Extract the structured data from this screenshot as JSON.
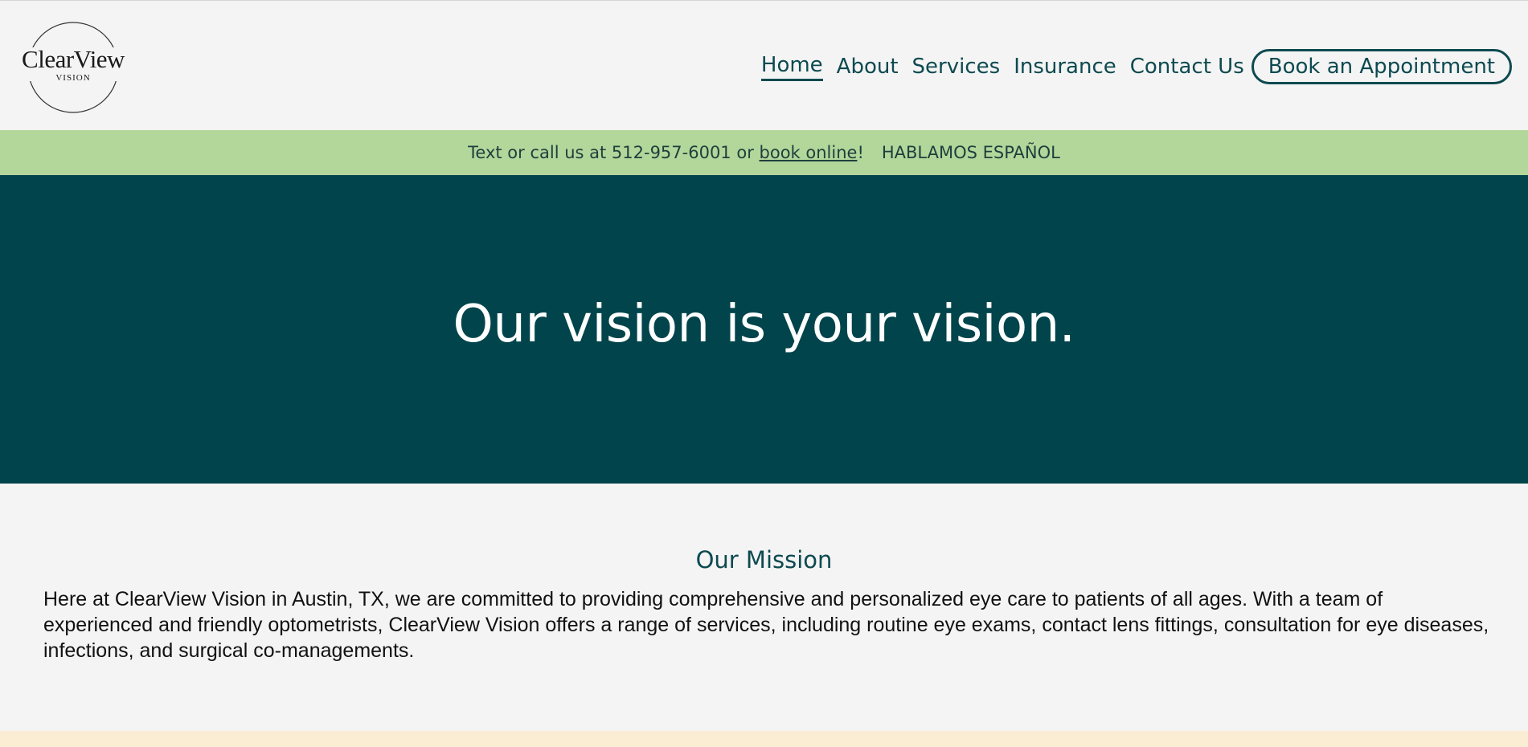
{
  "logo": {
    "name": "ClearView",
    "subtitle": "VISION"
  },
  "nav": {
    "items": [
      {
        "label": "Home",
        "active": true
      },
      {
        "label": "About",
        "active": false
      },
      {
        "label": "Services",
        "active": false
      },
      {
        "label": "Insurance",
        "active": false
      },
      {
        "label": "Contact Us",
        "active": false
      }
    ],
    "cta_label": "Book an Appointment"
  },
  "announce": {
    "prefix": "Text or call us at 512-957-6001 or ",
    "link_text": "book online",
    "suffix": "!",
    "spanish": "HABLAMOS ESPAÑOL"
  },
  "hero": {
    "headline": "Our vision is your vision."
  },
  "mission": {
    "title": "Our Mission",
    "body": "Here at ClearView Vision in Austin, TX, we are committed to providing comprehensive and personalized eye care to patients of all ages. With a team of experienced and friendly optometrists, ClearView Vision offers a range of services, including routine eye exams, contact lens fittings, consultation for eye diseases, infections, and surgical co-managements."
  },
  "colors": {
    "brand_teal": "#01444b",
    "nav_text": "#0d4a50",
    "announce_bg": "#b3d69b",
    "page_bg": "#f4f4f4",
    "footer_bg": "#fbecd4"
  }
}
